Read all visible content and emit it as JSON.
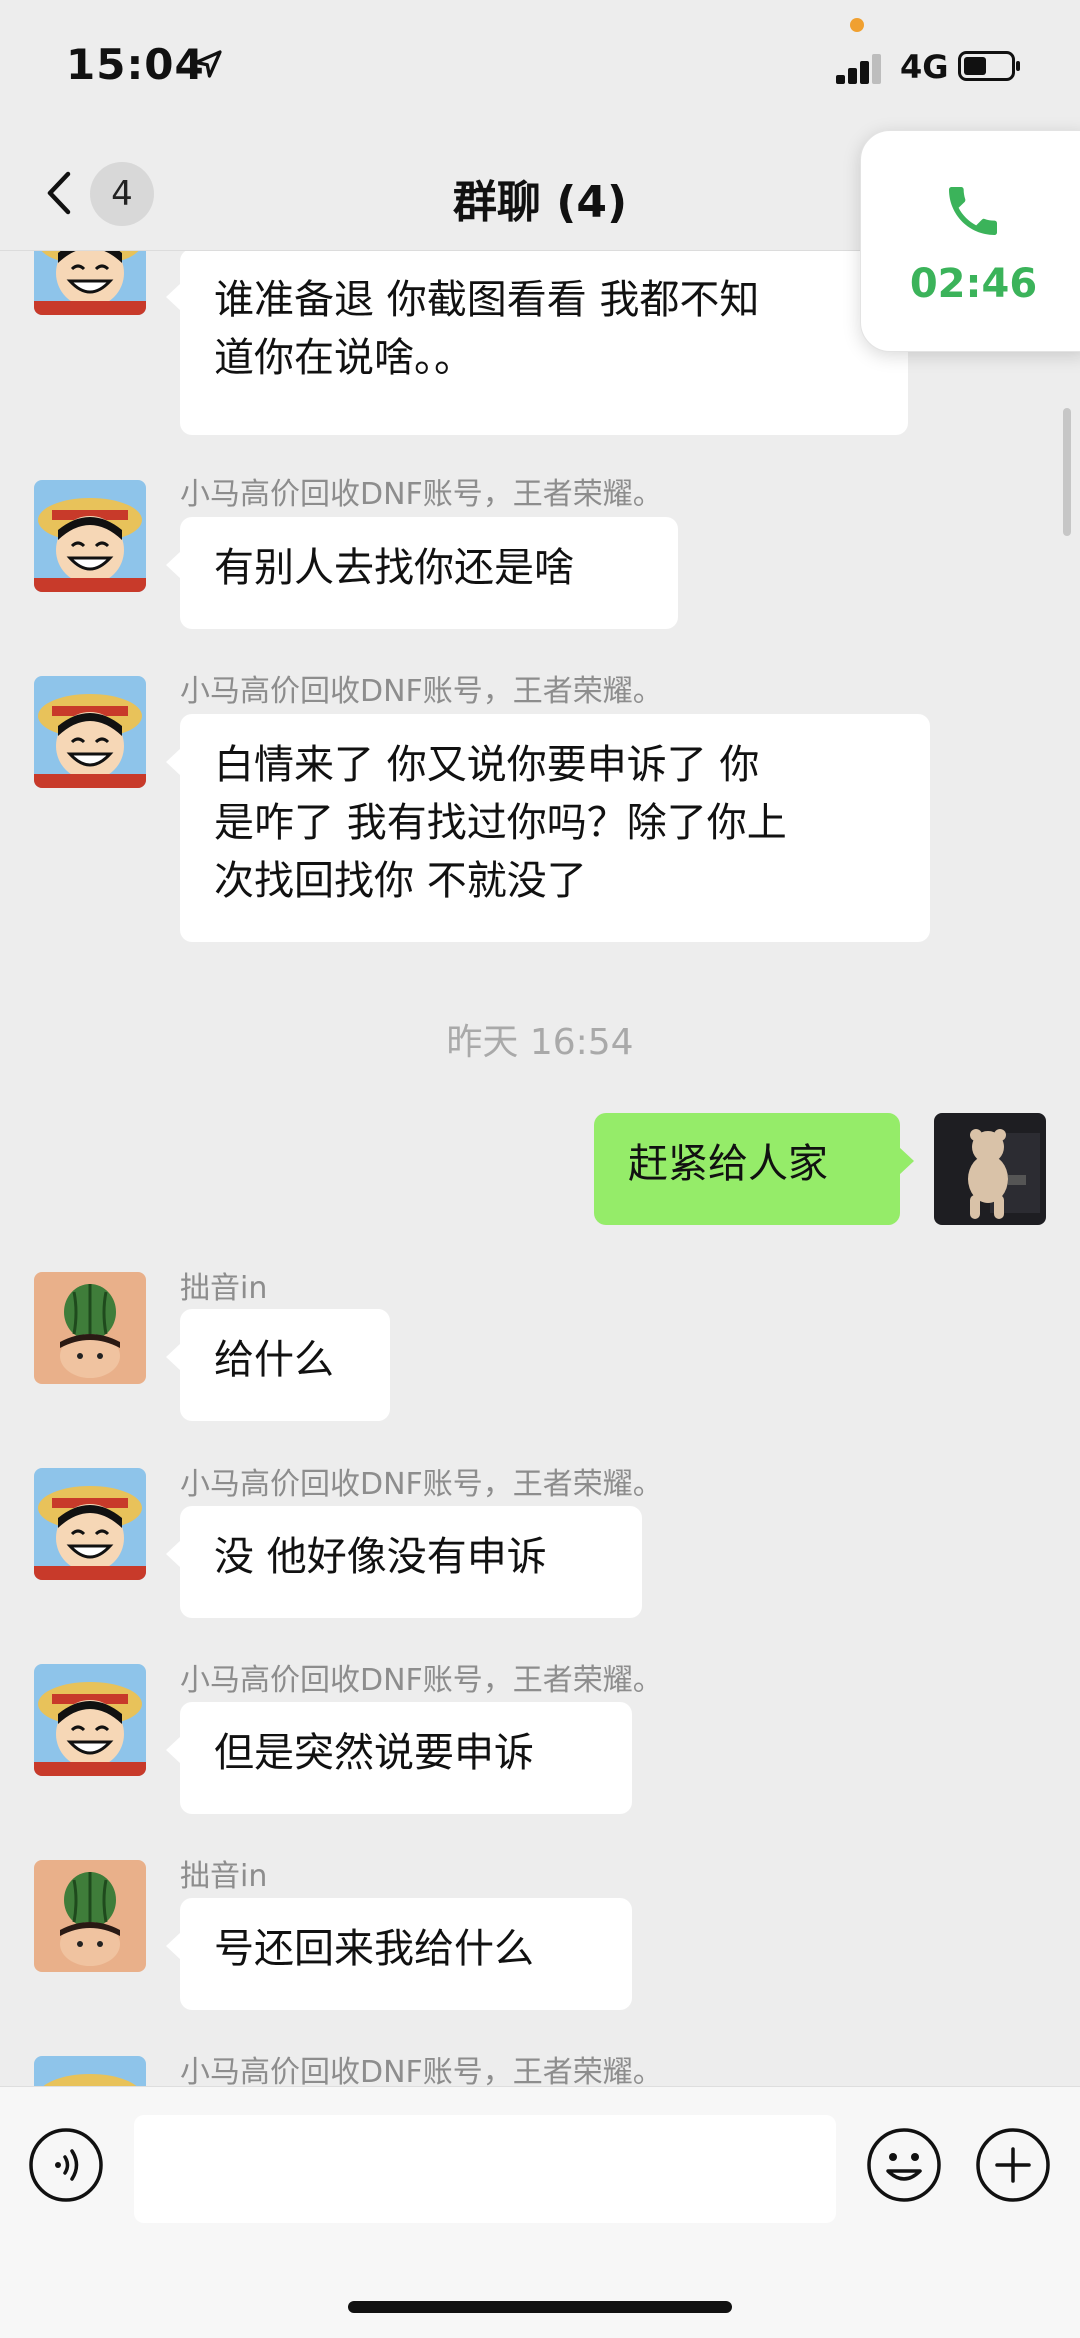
{
  "status_bar": {
    "time": "15:04",
    "network": "4G"
  },
  "nav": {
    "unread_count": "4",
    "title": "群聊 (4)"
  },
  "call": {
    "duration": "02:46",
    "accent": "#3bb35a"
  },
  "colors": {
    "my_bubble": "#95ec69",
    "other_bubble": "#ffffff",
    "background": "#ededed"
  },
  "messages": [
    {
      "sender": "",
      "text_lines": [
        "谁准备退  你截图看看 我都不知",
        "道你在说啥。。"
      ],
      "mine": false,
      "avatar": "luffy-avatar"
    },
    {
      "sender": "小马高价回收DNF账号，王者荣耀。",
      "text_lines": [
        "有别人去找你还是啥"
      ],
      "mine": false,
      "avatar": "luffy-avatar"
    },
    {
      "sender": "小马高价回收DNF账号，王者荣耀。",
      "text_lines": [
        "白情来了 你又说你要申诉了 你",
        "是咋了 我有找过你吗？除了你上",
        "次找回找你 不就没了"
      ],
      "mine": false,
      "avatar": "luffy-avatar"
    },
    {
      "sender": "",
      "text_lines": [
        "赶紧给人家"
      ],
      "mine": true,
      "avatar": "bear-avatar"
    },
    {
      "sender": "拙音in",
      "text_lines": [
        "给什么"
      ],
      "mine": false,
      "avatar": "watermelon-avatar"
    },
    {
      "sender": "小马高价回收DNF账号，王者荣耀。",
      "text_lines": [
        "没 他好像没有申诉"
      ],
      "mine": false,
      "avatar": "luffy-avatar"
    },
    {
      "sender": "小马高价回收DNF账号，王者荣耀。",
      "text_lines": [
        "但是突然说要申诉"
      ],
      "mine": false,
      "avatar": "luffy-avatar"
    },
    {
      "sender": "拙音in",
      "text_lines": [
        "号还回来我给什么"
      ],
      "mine": false,
      "avatar": "watermelon-avatar"
    },
    {
      "sender": "小马高价回收DNF账号，王者荣耀。",
      "text_lines": [],
      "mine": false,
      "avatar": "luffy-avatar"
    }
  ],
  "timestamp": "昨天 16:54",
  "input": {
    "value": "",
    "placeholder": ""
  }
}
